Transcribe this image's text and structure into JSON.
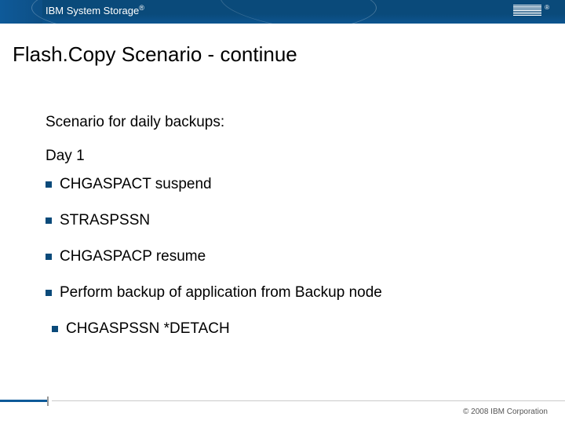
{
  "header": {
    "product": "IBM System Storage",
    "reg": "®",
    "logo_alt": "IBM"
  },
  "title": "Flash.Copy Scenario - continue",
  "subtitle1": "Scenario for daily backups:",
  "subtitle2": "Day 1",
  "bullets": [
    "CHGASPACT suspend",
    "STRASPSSN",
    "CHGASPACP resume",
    "Perform backup of application from Backup node",
    " CHGASPSSN *DETACH"
  ],
  "footer": {
    "copyright": "© 2008 IBM Corporation"
  }
}
